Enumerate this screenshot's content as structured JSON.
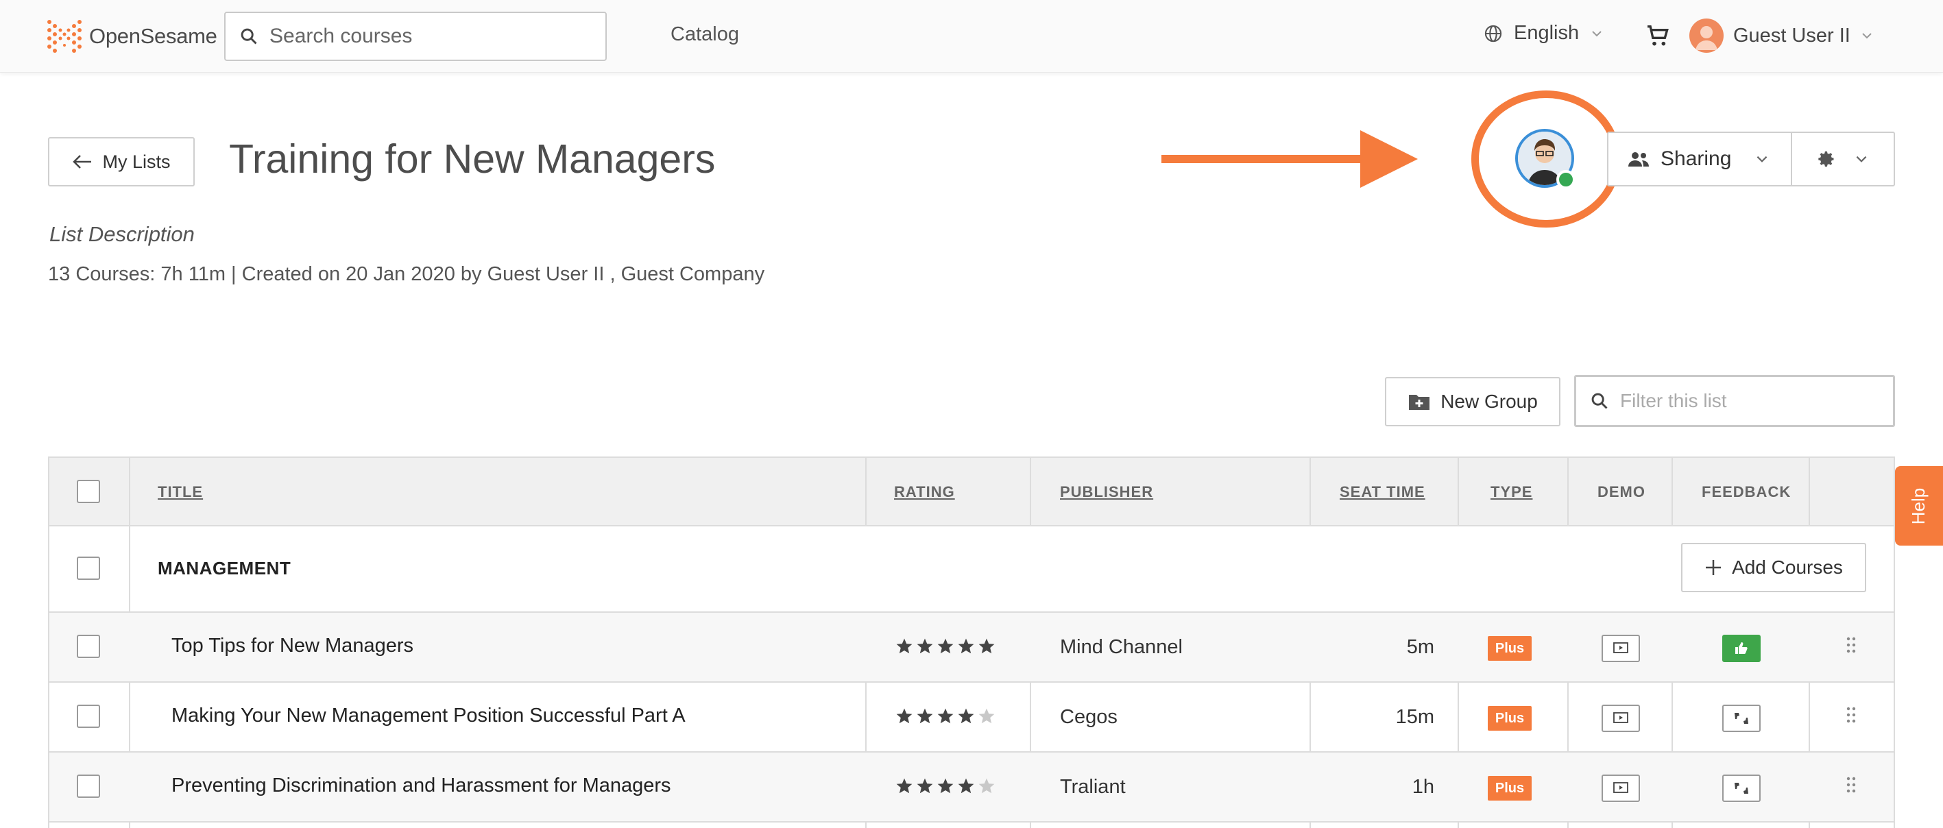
{
  "brand": {
    "name": "OpenSesame",
    "accent": "#f57b3c"
  },
  "nav": {
    "search_placeholder": "Search courses",
    "catalog": "Catalog",
    "language": "English",
    "user_name": "Guest User II"
  },
  "header": {
    "back_label": "My Lists",
    "title": "Training for New Managers",
    "sharing_label": "Sharing",
    "description": "List Description",
    "meta": "13 Courses: 7h 11m | Created on 20 Jan 2020 by Guest User II , Guest Company"
  },
  "toolbar": {
    "new_group_label": "New Group",
    "filter_placeholder": "Filter this list"
  },
  "table": {
    "columns": [
      "TITLE",
      "RATING",
      "PUBLISHER",
      "SEAT TIME",
      "TYPE",
      "DEMO",
      "FEEDBACK"
    ],
    "group": {
      "title": "MANAGEMENT",
      "add_label": "Add Courses"
    },
    "rows": [
      {
        "title": "Top Tips for New Managers",
        "rating": 5,
        "publisher": "Mind Channel",
        "seat_time": "5m",
        "type": "Plus",
        "feedback": "liked"
      },
      {
        "title": "Making Your New Management Position Successful Part A",
        "rating": 4,
        "publisher": "Cegos",
        "seat_time": "15m",
        "type": "Plus",
        "feedback": "neutral"
      },
      {
        "title": "Preventing Discrimination and Harassment for Managers",
        "rating": 4,
        "publisher": "Traliant",
        "seat_time": "1h",
        "type": "Plus",
        "feedback": "neutral"
      }
    ]
  },
  "help": {
    "label": "Help"
  }
}
